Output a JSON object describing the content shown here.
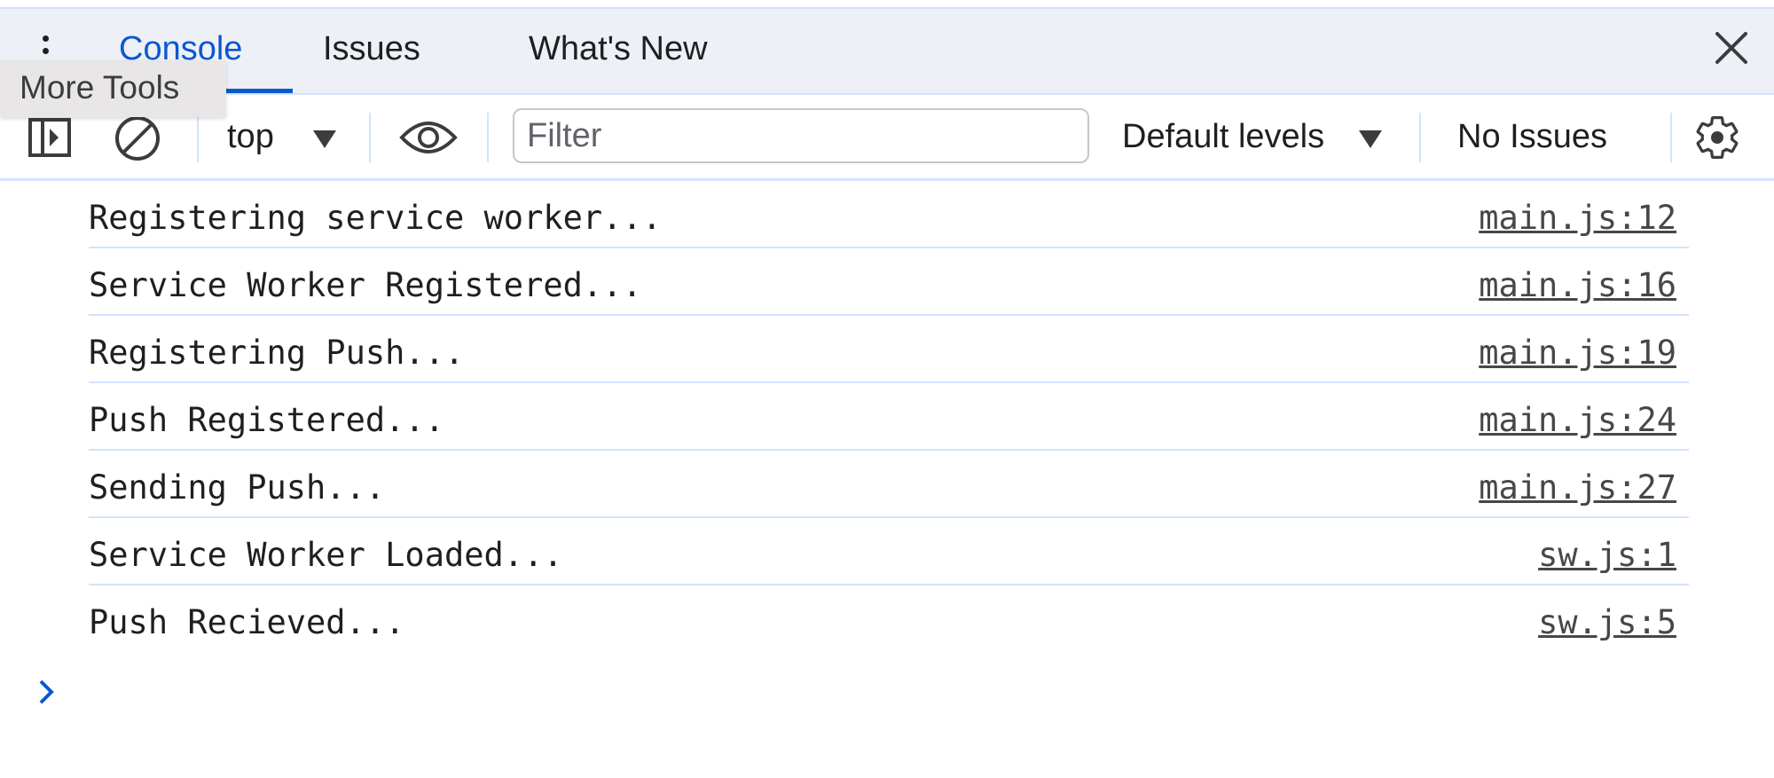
{
  "tabs": [
    {
      "label": "Console",
      "active": true
    },
    {
      "label": "Issues",
      "active": false
    },
    {
      "label": "What's New",
      "active": false
    }
  ],
  "tooltip": {
    "text": "More Tools"
  },
  "toolbar": {
    "context": "top",
    "filter_placeholder": "Filter",
    "filter_value": "",
    "levels": "Default levels",
    "issues": "No Issues"
  },
  "console": {
    "messages": [
      {
        "text": "Registering service worker...",
        "source": "main.js:12"
      },
      {
        "text": "Service Worker Registered...",
        "source": "main.js:16"
      },
      {
        "text": "Registering Push...",
        "source": "main.js:19"
      },
      {
        "text": "Push Registered...",
        "source": "main.js:24"
      },
      {
        "text": "Sending Push...",
        "source": "main.js:27"
      },
      {
        "text": "Service Worker Loaded...",
        "source": "sw.js:1"
      },
      {
        "text": "Push Recieved...",
        "source": "sw.js:5"
      }
    ]
  },
  "colors": {
    "accent": "#0b57d0",
    "tabbar_bg": "#edf0f6",
    "divider": "#d3e3fd"
  }
}
